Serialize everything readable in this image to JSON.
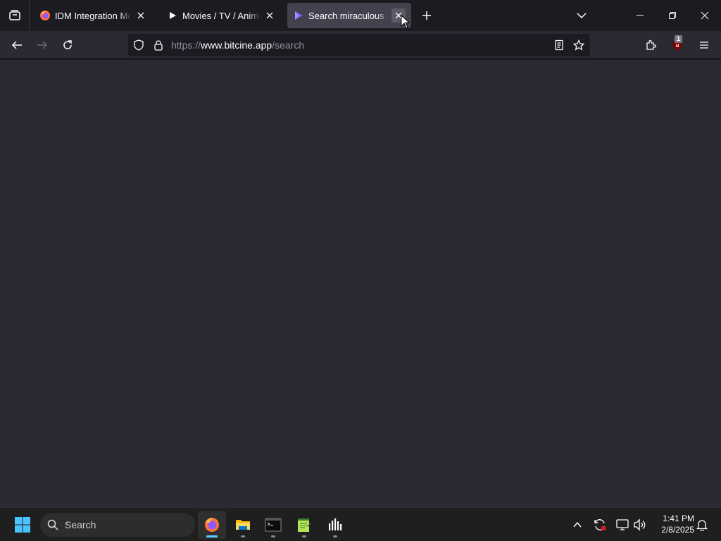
{
  "browser": {
    "tabs": [
      {
        "title": "IDM Integration Module",
        "favicon": "firefox-icon",
        "active": false
      },
      {
        "title": "Movies / TV / Anime • Bitcine",
        "favicon": "play-icon",
        "active": false
      },
      {
        "title": "Search miraculous - Bitcine",
        "favicon": "bitcine-icon",
        "active": true
      }
    ],
    "url": {
      "scheme": "https://",
      "host": "www.bitcine.app",
      "path": "/search"
    },
    "extension_badge": "1"
  },
  "taskbar": {
    "search_placeholder": "Search",
    "apps": [
      "firefox-icon",
      "file-explorer-icon",
      "terminal-icon",
      "notepad-icon",
      "audio-app-icon"
    ],
    "clock": {
      "time": "1:41 PM",
      "date": "2/8/2025"
    }
  },
  "colors": {
    "content_bg": "#2b2a33",
    "tab_strip": "#1c1b22",
    "accent": "#60cdff"
  }
}
